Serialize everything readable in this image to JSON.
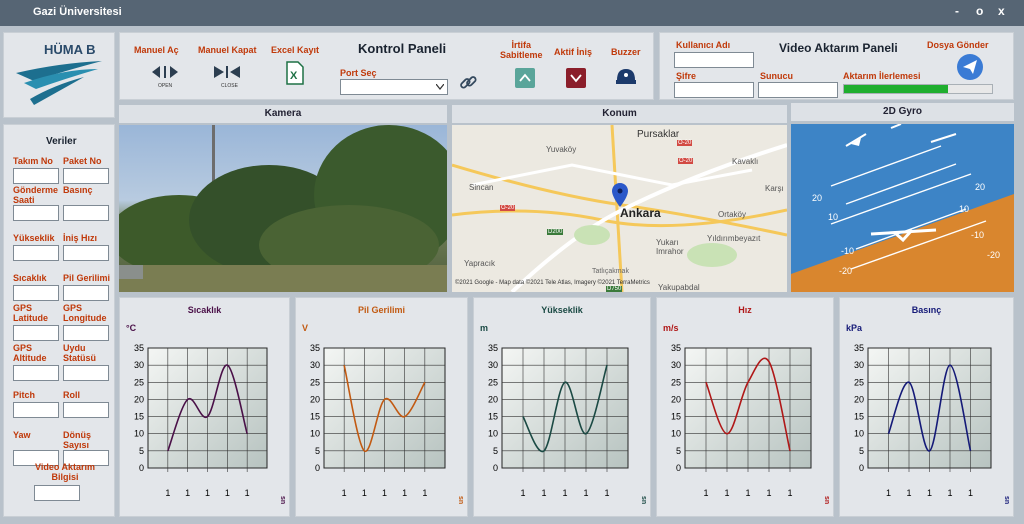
{
  "window": {
    "title": "Gazi Üniversitesi",
    "min": "-",
    "max": "o",
    "close": "x"
  },
  "logo": {
    "text": "HÜMA B"
  },
  "control": {
    "title": "Kontrol Paneli",
    "manual_open": "Manuel Aç",
    "manual_open_sub": "OPEN",
    "manual_close": "Manuel Kapat",
    "manual_close_sub": "CLOSE",
    "excel": "Excel Kayıt",
    "port_label": "Port Seç",
    "irtifa": "İrtifa\nSabitleme",
    "aktif": "Aktif İniş",
    "buzzer": "Buzzer"
  },
  "video": {
    "title": "Video Aktarım Paneli",
    "username": "Kullanıcı Adı",
    "password": "Şifre",
    "server": "Sunucu",
    "progress_label": "Aktarım İlerlemesi",
    "send_file": "Dosya Gönder",
    "progress": 0.7
  },
  "views": {
    "camera": "Kamera",
    "location": "Konum",
    "gyro": "2D Gyro"
  },
  "map": {
    "places": [
      "Pursaklar",
      "Yuvaköy",
      "Kavaklı",
      "Karşı",
      "Sincan",
      "Ankara",
      "Ortaköy",
      "Yukarı\nImrahor",
      "Yıldırımbeyazıt",
      "Yapracık",
      "Tatlıçakmak",
      "Yakupabdal"
    ],
    "roads": [
      "O-20",
      "O-20",
      "D200",
      "D750",
      "O-20"
    ],
    "attribution": "©2021 Google - Map data ©2021 Tele Atlas, Imagery ©2021 TerraMetrics"
  },
  "gyro": {
    "ticks": [
      "20",
      "10",
      "-10",
      "-20",
      "10",
      "20",
      "-10",
      "-20"
    ]
  },
  "data_panel": {
    "title": "Veriler",
    "fields": [
      [
        "Takım No",
        "Paket No"
      ],
      [
        "Gönderme Saati",
        "Basınç"
      ],
      [
        "Yükseklik",
        "İniş Hızı"
      ],
      [
        "Sıcaklık",
        "Pil Gerilimi"
      ],
      [
        "GPS Latitude",
        "GPS Longitude"
      ],
      [
        "GPS Altitude",
        "Uydu Statüsü"
      ],
      [
        "Pitch",
        "Roll"
      ],
      [
        "Yaw",
        "Dönüş Sayısı"
      ]
    ],
    "video_info": "Video Aktarım Bilgisi"
  },
  "chart_data": [
    {
      "type": "line",
      "title": "Sıcaklık",
      "unit": "°C",
      "color": "#4a1048",
      "x": [
        "1",
        "1",
        "1",
        "1",
        "1"
      ],
      "xlabel": "sn",
      "ylim": [
        0,
        35
      ],
      "yticks": [
        0,
        5,
        10,
        15,
        20,
        25,
        30,
        35
      ],
      "values": [
        5,
        20,
        15,
        30,
        10
      ]
    },
    {
      "type": "line",
      "title": "Pil Gerilimi",
      "unit": "V",
      "color": "#c25a12",
      "x": [
        "1",
        "1",
        "1",
        "1",
        "1"
      ],
      "xlabel": "sn",
      "ylim": [
        0,
        35
      ],
      "yticks": [
        0,
        5,
        10,
        15,
        20,
        25,
        30,
        35
      ],
      "values": [
        30,
        5,
        20,
        15,
        25
      ]
    },
    {
      "type": "line",
      "title": "Yükseklik",
      "unit": "m",
      "color": "#1b4a44",
      "x": [
        "1",
        "1",
        "1",
        "1",
        "1"
      ],
      "xlabel": "sn",
      "ylim": [
        0,
        35
      ],
      "yticks": [
        0,
        5,
        10,
        15,
        20,
        25,
        30,
        35
      ],
      "values": [
        15,
        5,
        25,
        10,
        30
      ]
    },
    {
      "type": "line",
      "title": "Hız",
      "unit": "m/s",
      "color": "#b01818",
      "x": [
        "1",
        "1",
        "1",
        "1",
        "1"
      ],
      "xlabel": "sn",
      "ylim": [
        0,
        35
      ],
      "yticks": [
        0,
        5,
        10,
        15,
        20,
        25,
        30,
        35
      ],
      "values": [
        25,
        10,
        25,
        31,
        5
      ]
    },
    {
      "type": "line",
      "title": "Basınç",
      "unit": "kPa",
      "color": "#151a78",
      "x": [
        "1",
        "1",
        "1",
        "1",
        "1"
      ],
      "xlabel": "sn",
      "ylim": [
        0,
        35
      ],
      "yticks": [
        0,
        5,
        10,
        15,
        20,
        25,
        30,
        35
      ],
      "values": [
        10,
        25,
        5,
        30,
        5
      ]
    }
  ]
}
